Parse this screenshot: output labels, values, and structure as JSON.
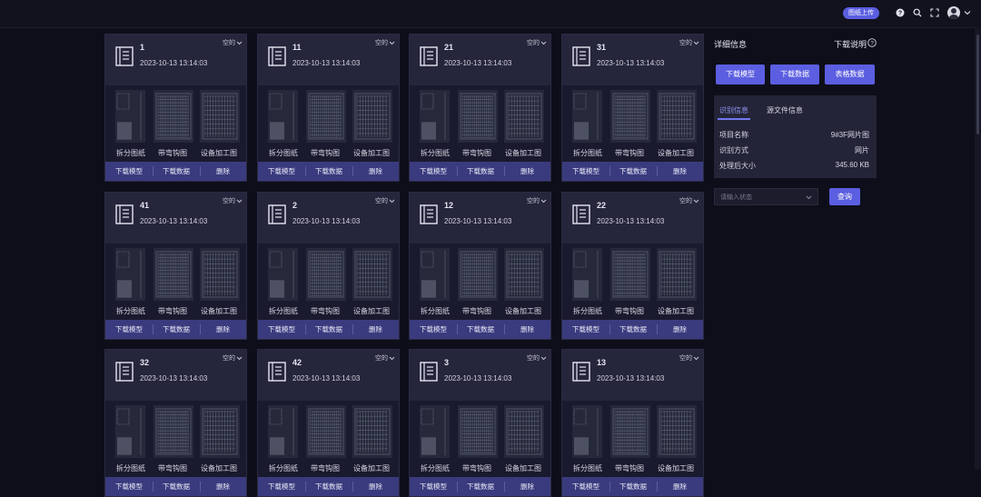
{
  "header": {
    "upload_label": "图纸上传",
    "icons": [
      "help-circle-icon",
      "search-icon",
      "fullscreen-icon",
      "avatar-icon",
      "chevron-down-icon"
    ]
  },
  "cards": [
    {
      "number": "1",
      "date": "2023-10-13 13:14:03",
      "status": "空的"
    },
    {
      "number": "11",
      "date": "2023-10-13 13:14:03",
      "status": "空的"
    },
    {
      "number": "21",
      "date": "2023-10-13 13:14:03",
      "status": "空的"
    },
    {
      "number": "31",
      "date": "2023-10-13 13:14:03",
      "status": "空的"
    },
    {
      "number": "41",
      "date": "2023-10-13 13:14:03",
      "status": "空的"
    },
    {
      "number": "2",
      "date": "2023-10-13 13:14:03",
      "status": "空的"
    },
    {
      "number": "12",
      "date": "2023-10-13 13:14:03",
      "status": "空的"
    },
    {
      "number": "22",
      "date": "2023-10-13 13:14:03",
      "status": "空的"
    },
    {
      "number": "32",
      "date": "2023-10-13 13:14:03",
      "status": "空的"
    },
    {
      "number": "42",
      "date": "2023-10-13 13:14:03",
      "status": "空的"
    },
    {
      "number": "3",
      "date": "2023-10-13 13:14:03",
      "status": "空的"
    },
    {
      "number": "13",
      "date": "2023-10-13 13:14:03",
      "status": "空的"
    }
  ],
  "card_labels": {
    "thumb_a": "拆分图纸",
    "thumb_b": "带弯钩图",
    "thumb_c": "设备加工图",
    "action_model": "下载模型",
    "action_data": "下载数据",
    "action_delete": "删除"
  },
  "panel": {
    "title": "详细信息",
    "help_label": "下载说明",
    "buttons": [
      "下载模型",
      "下载数据",
      "表格数据"
    ],
    "tabs": [
      "识别信息",
      "源文件信息"
    ],
    "info": [
      {
        "key": "项目名称",
        "value": "9#3F网片图"
      },
      {
        "key": "识别方式",
        "value": "网片"
      },
      {
        "key": "处理后大小",
        "value": "345.60 KB"
      }
    ]
  },
  "filter": {
    "placeholder": "请输入状态",
    "query_label": "查询"
  },
  "colors": {
    "accent": "#5b5ee0",
    "card_action_bar": "#3a3b7e",
    "background": "#0e0e1a"
  }
}
